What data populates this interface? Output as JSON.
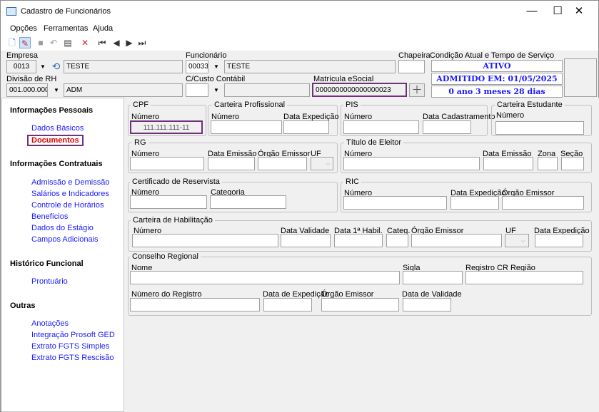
{
  "window": {
    "title": "Cadastro de Funcionários",
    "minimize": "—",
    "maximize": "☐",
    "close": "✕"
  },
  "menu": [
    "Opções",
    "Ferramentas",
    "Ajuda"
  ],
  "header": {
    "empresa_label": "Empresa",
    "empresa_code": "0013",
    "empresa_name": "TESTE",
    "funcionario_label": "Funcionário",
    "funcionario_code": "00033",
    "funcionario_name": "TESTE",
    "chapeira_label": "Chapeira",
    "chapeira_value": "",
    "condicao_label": "Condição Atual e Tempo de Serviço",
    "status_ativo": "ATIVO",
    "admitido": "ADMITIDO EM: 01/05/2025",
    "tempo": "0 ano 3 meses 28 dias",
    "divisao_label": "Divisão de RH",
    "divisao_code": "001.000.000",
    "divisao_name": "ADM",
    "ccusto_label": "C/Custo Contábil",
    "matricula_label": "Matrícula eSocial",
    "matricula_value": "0000000000000000023"
  },
  "sidebar": {
    "sections": [
      {
        "title": "Informações Pessoais",
        "items": [
          "Dados Básicos",
          "Documentos"
        ]
      },
      {
        "title": "Informações Contratuais",
        "items": [
          "Admissão e Demissão",
          "Salários e Indicadores",
          "Controle de Horários",
          "Benefícios",
          "Dados do Estágio",
          "Campos Adicionais"
        ]
      },
      {
        "title": "Histórico Funcional",
        "items": [
          "Prontuário"
        ]
      },
      {
        "title": "Outras",
        "items": [
          "Anotações",
          "Integração Prosoft GED",
          "Extrato FGTS Simples",
          "Extrato FGTS Rescisão"
        ]
      }
    ]
  },
  "docs": {
    "cpf": {
      "title": "CPF",
      "numero_label": "Número",
      "numero": "111.111.111-11"
    },
    "cp": {
      "title": "Carteira Profissional",
      "numero_label": "Número",
      "data_label": "Data Expedição"
    },
    "pis": {
      "title": "PIS",
      "numero_label": "Número",
      "data_label": "Data Cadastramento"
    },
    "ce": {
      "title": "Carteira Estudante",
      "numero_label": "Número"
    },
    "rg": {
      "title": "RG",
      "numero_label": "Número",
      "emissao_label": "Data Emissão",
      "orgao_label": "Órgão Emissor",
      "uf_label": "UF"
    },
    "te": {
      "title": "Título de Eleitor",
      "numero_label": "Número",
      "emissao_label": "Data Emissão",
      "zona_label": "Zona",
      "secao_label": "Seção"
    },
    "cr": {
      "title": "Certificado de Reservista",
      "numero_label": "Número",
      "categoria_label": "Categoria"
    },
    "ric": {
      "title": "RIC",
      "numero_label": "Número",
      "data_label": "Data Expedição",
      "orgao_label": "Órgão Emissor"
    },
    "ch": {
      "title": "Carteira de Habilitação",
      "numero_label": "Número",
      "validade_label": "Data Validade",
      "hab_label": "Data 1ª Habil.",
      "categ_label": "Categ.",
      "orgao_label": "Órgão Emissor",
      "uf_label": "UF",
      "exp_label": "Data Expedição"
    },
    "cons": {
      "title": "Conselho Regional",
      "nome_label": "Nome",
      "sigla_label": "Sigla",
      "registro_regiao_label": "Registro CR Região",
      "numreg_label": "Número do Registro",
      "exp_label": "Data de Expedição",
      "orgao_label": "Órgão Emissor",
      "validade_label": "Data de Validade"
    }
  }
}
